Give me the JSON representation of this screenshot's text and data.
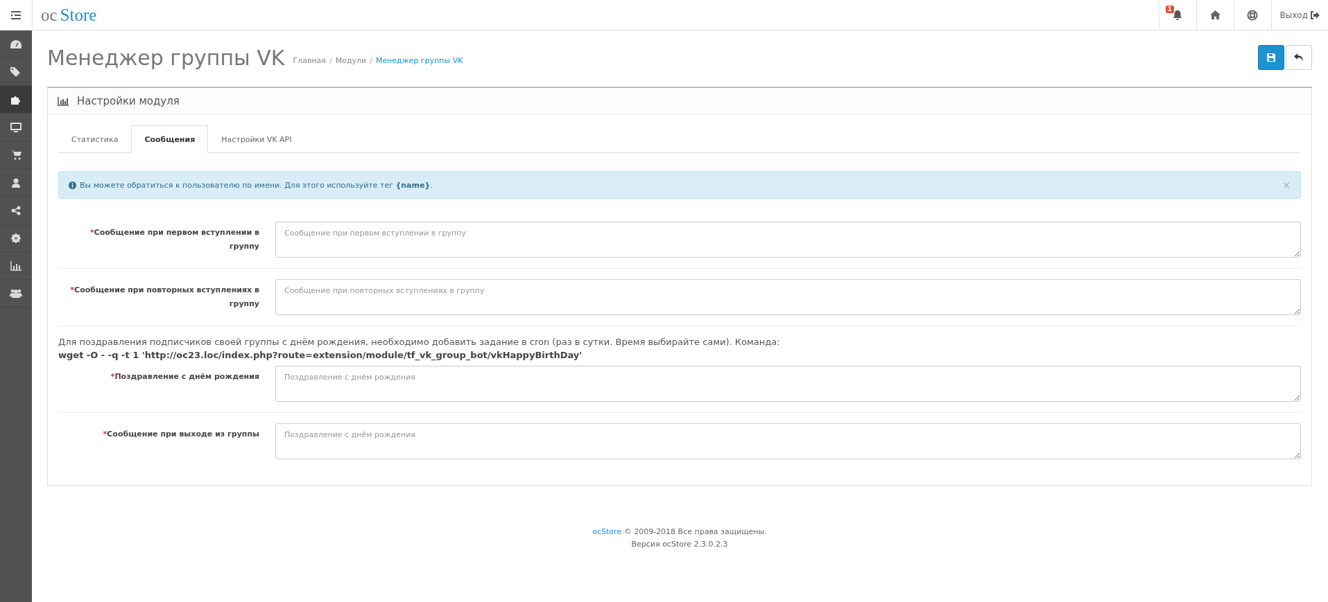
{
  "header": {
    "logo_prefix": "oc",
    "logo_main": "Store",
    "notification_count": "1",
    "logout": "Выход"
  },
  "sidebar": {
    "items": [
      {
        "kind": "dashboard",
        "selected": false
      },
      {
        "kind": "tags",
        "selected": false
      },
      {
        "kind": "puzzle",
        "selected": true
      },
      {
        "kind": "monitor",
        "selected": false
      },
      {
        "kind": "cart",
        "selected": false
      },
      {
        "kind": "user",
        "selected": false
      },
      {
        "kind": "share",
        "selected": false
      },
      {
        "kind": "gear",
        "selected": false
      },
      {
        "kind": "chart",
        "selected": false
      },
      {
        "kind": "users",
        "selected": false
      }
    ]
  },
  "page": {
    "title": "Менеджер группы VK",
    "breadcrumbs": [
      {
        "label": "Главная",
        "current": false
      },
      {
        "separator": "/",
        "label": "Модули",
        "current": false
      },
      {
        "separator": "/",
        "label": "Менеджер группы VK",
        "current": true
      }
    ]
  },
  "panel": {
    "title": "Настройки модуля",
    "tabs": [
      {
        "label": "Статистика",
        "selected": false
      },
      {
        "label": "Сообщения",
        "selected": true
      },
      {
        "label": "Настройки VK API",
        "selected": false
      }
    ],
    "alert": {
      "text": "Вы можете обратиться к пользователю по имени. Для этого используйте тег **{name}**.",
      "close": "×"
    },
    "fields": [
      {
        "label": "Сообщение при первом вступлении в группу",
        "required_mark": "*",
        "placeholder": "Сообщение при первом вступлении в группу"
      },
      {
        "label": "Сообщение при повторных вступлениях в группу",
        "required_mark": "*",
        "placeholder": "Сообщение при повторных вступлениях в группу"
      },
      {
        "note": "Для поздравления подписчиков своей группы с днём рождения, необходимо добавить задание в cron (раз в сутки. Время выбирайте сами). Команда:",
        "command": "wget -O - -q -t 1 'http://oc23.loc/index.php?route=extension/module/tf_vk_group_bot/vkHappyBirthDay'",
        "label": "Поздравление с днём рождения",
        "required_mark": "*",
        "placeholder": "Поздравление с днём рождения"
      },
      {
        "label": "Сообщение при выходе из группы",
        "required_mark": "*",
        "placeholder": "Поздравление с днём рождения"
      }
    ]
  },
  "footer": {
    "link": "ocStore",
    "text": "© 2009-2018 Все права защищены.",
    "version": "Версия ocStore 2.3.0.2.3"
  }
}
